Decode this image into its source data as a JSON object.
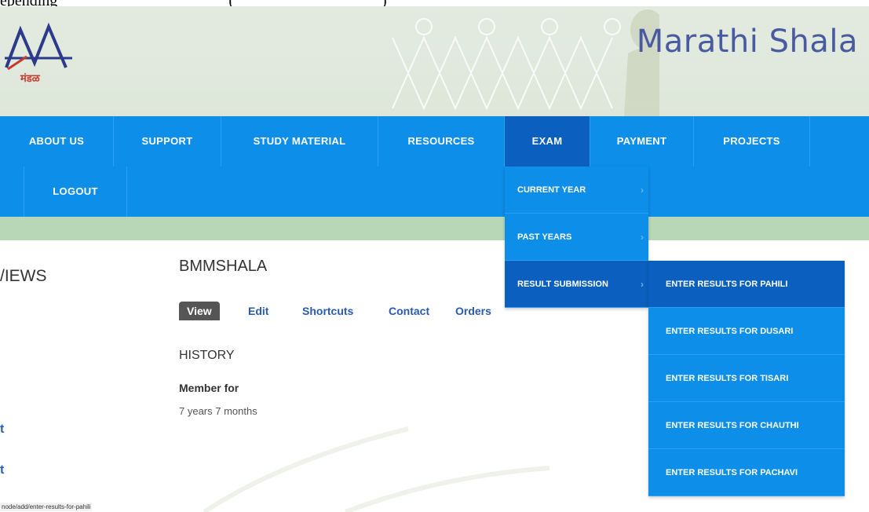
{
  "top": {
    "text_before": "epending",
    "link_text": "",
    "text_after": ")"
  },
  "site": {
    "name": "Marathi Shala",
    "logo_text": "मंडळ"
  },
  "nav": {
    "items": [
      {
        "label": "ABOUT US"
      },
      {
        "label": "SUPPORT"
      },
      {
        "label": "STUDY MATERIAL"
      },
      {
        "label": "RESOURCES"
      },
      {
        "label": "EXAM",
        "active": true
      },
      {
        "label": "PAYMENT"
      },
      {
        "label": "PROJECTS"
      }
    ],
    "row2": [
      {
        "label": "LOGOUT"
      }
    ]
  },
  "exam_menu": {
    "items": [
      {
        "label": "CURRENT YEAR",
        "arrow": "›"
      },
      {
        "label": "PAST YEARS",
        "arrow": "›"
      },
      {
        "label": "RESULT SUBMISSION",
        "arrow": "›",
        "active": true
      }
    ]
  },
  "result_submenu": {
    "items": [
      {
        "label": "ENTER RESULTS FOR PAHILI",
        "active": true
      },
      {
        "label": "ENTER RESULTS FOR DUSARI"
      },
      {
        "label": "ENTER RESULTS FOR TISARI"
      },
      {
        "label": "ENTER RESULTS FOR CHAUTHI"
      },
      {
        "label": "ENTER RESULTS FOR PACHAVI"
      }
    ]
  },
  "sidebar": {
    "heading": "/IEWS",
    "links": [
      "t",
      "t"
    ]
  },
  "profile": {
    "username": "BMMSHALA",
    "tabs": [
      "View",
      "Edit",
      "Shortcuts",
      "Contact",
      "Orders"
    ],
    "history_heading": "HISTORY",
    "member_label": "Member for",
    "member_value": "7 years 7 months"
  },
  "status_bar": {
    "url": "node/add/enter-results-for-pahili"
  },
  "colors": {
    "nav_bg": "#0d8ee8",
    "nav_active": "#0b5fbf",
    "green_band": "#b7d7b7",
    "site_name": "#4a5aa0"
  }
}
